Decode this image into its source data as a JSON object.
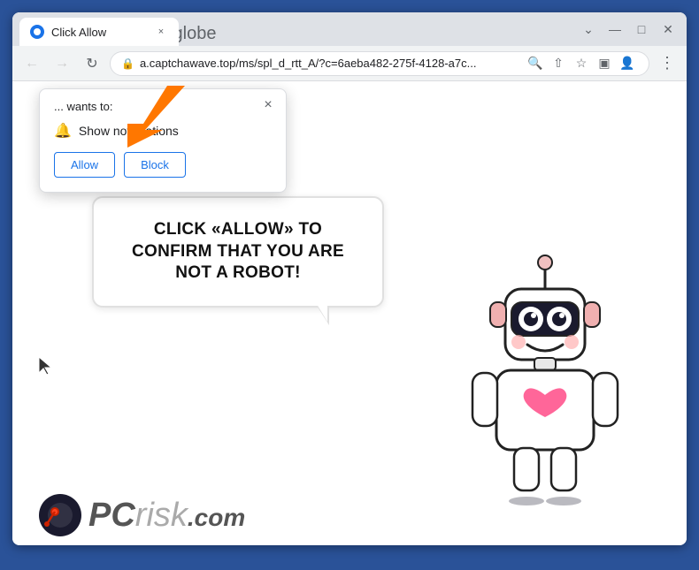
{
  "browser": {
    "tab_title": "Click Allow",
    "tab_favicon": "globe",
    "close_tab_label": "×",
    "new_tab_label": "+",
    "window_controls": {
      "minimize": "—",
      "maximize": "□",
      "close": "✕"
    },
    "nav": {
      "back": "←",
      "forward": "→",
      "refresh": "↻"
    },
    "url": "a.captchawave.top/ms/spl_d_rtt_A/?c=6aeba482-275f-4128-a7c...",
    "url_actions": {
      "search": "🔍",
      "share": "⇧",
      "bookmark": "☆",
      "split": "▣",
      "profile": "👤",
      "menu": "⋮"
    }
  },
  "notification_popup": {
    "site_text": "... wants to:",
    "permission_text": "Show notifications",
    "allow_label": "Allow",
    "block_label": "Block",
    "close_label": "×"
  },
  "page": {
    "bubble_text": "CLICK «ALLOW» TO CONFIRM THAT YOU ARE NOT A ROBOT!"
  },
  "logo": {
    "text_pc": "PC",
    "text_risk": "risk",
    "text_dot_com": ".com"
  },
  "colors": {
    "browser_border": "#2a5298",
    "accent_blue": "#1a73e8",
    "orange": "#ff6600",
    "tab_bg": "#dee1e6"
  }
}
